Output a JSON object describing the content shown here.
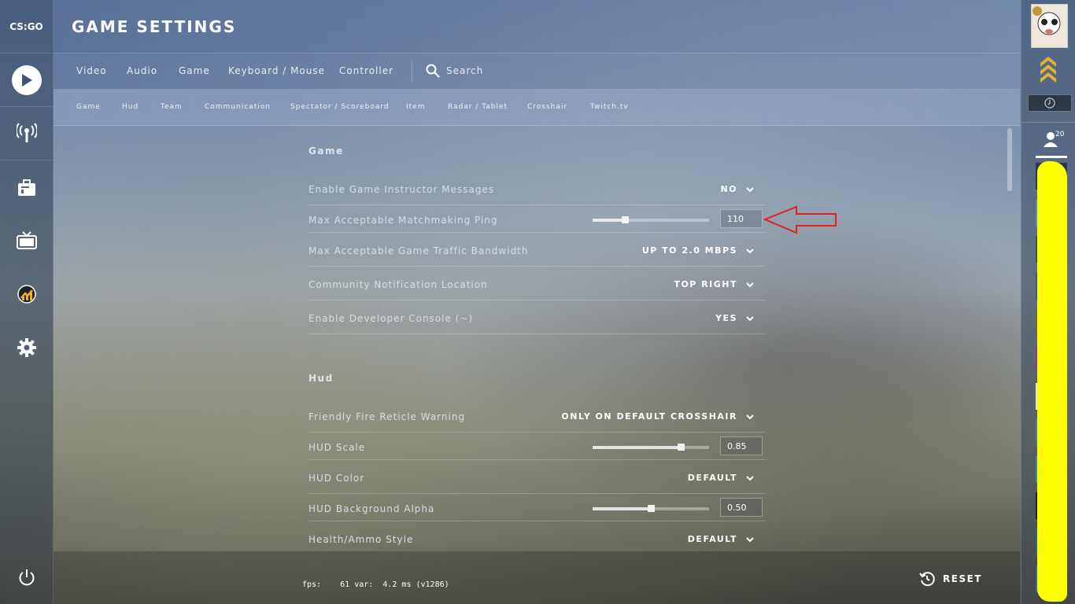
{
  "app": {
    "logo_text": "CS:GO",
    "page_title": "GAME SETTINGS"
  },
  "leftnav": {
    "items": [
      "play-icon",
      "broadcast-icon",
      "inventory-icon",
      "watch-icon",
      "stats-icon",
      "settings-gear-icon",
      "power-icon"
    ]
  },
  "tabs": [
    {
      "label": "Video"
    },
    {
      "label": "Audio"
    },
    {
      "label": "Game"
    },
    {
      "label": "Keyboard / Mouse"
    },
    {
      "label": "Controller"
    }
  ],
  "search": {
    "label": "Search"
  },
  "subtabs": [
    {
      "label": "Game"
    },
    {
      "label": "Hud"
    },
    {
      "label": "Team"
    },
    {
      "label": "Communication"
    },
    {
      "label": "Spectator / Scoreboard"
    },
    {
      "label": "Item"
    },
    {
      "label": "Radar / Tablet"
    },
    {
      "label": "Crosshair"
    },
    {
      "label": "Twitch.tv"
    }
  ],
  "sections": {
    "game": {
      "title": "Game",
      "rows": [
        {
          "label": "Enable Game Instructor Messages",
          "value": "NO"
        },
        {
          "label": "Max Acceptable Matchmaking Ping",
          "value": "110",
          "slider_fraction": 0.28
        },
        {
          "label": "Max Acceptable Game Traffic Bandwidth",
          "value": "UP TO 2.0 MBPS"
        },
        {
          "label": "Community Notification Location",
          "value": "TOP RIGHT"
        },
        {
          "label": "Enable Developer Console (~)",
          "value": "YES"
        }
      ]
    },
    "hud": {
      "title": "Hud",
      "rows": [
        {
          "label": "Friendly Fire Reticle Warning",
          "value": "ONLY ON DEFAULT CROSSHAIR"
        },
        {
          "label": "HUD Scale",
          "value": "0.85",
          "slider_fraction": 0.76
        },
        {
          "label": "HUD Color",
          "value": "DEFAULT"
        },
        {
          "label": "HUD Background Alpha",
          "value": "0.50",
          "slider_fraction": 0.5
        },
        {
          "label": "Health/Ammo Style",
          "value": "DEFAULT"
        }
      ]
    }
  },
  "footer": {
    "fps_text": "fps:    61 var:  4.2 ms (v1286)",
    "reset_label": "RESET"
  },
  "rightpanel": {
    "friends_count": "20"
  },
  "colors": {
    "annotation_arrow": "#e0211c",
    "scribble": "#ffff00"
  }
}
